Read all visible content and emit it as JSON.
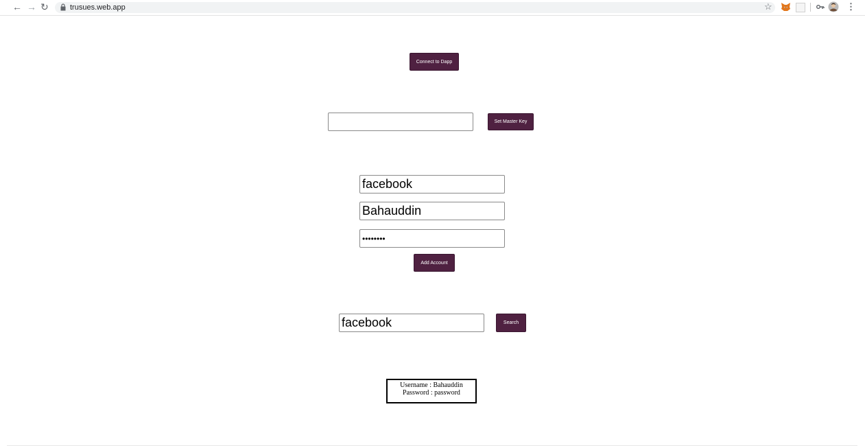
{
  "browser": {
    "url": "trusues.web.app",
    "icons": [
      "back-icon",
      "forward-icon",
      "reload-icon",
      "lock-icon",
      "star-icon",
      "metamask-icon",
      "extension-icon",
      "key-icon",
      "profile-avatar",
      "menu-icon"
    ]
  },
  "connect": {
    "label": "Connect to Dapp"
  },
  "master_key": {
    "value": "",
    "button_label": "Set Master Key"
  },
  "account": {
    "site_value": "facebook",
    "username_value": "Bahauddin",
    "password_value": "password",
    "button_label": "Add Account"
  },
  "search": {
    "value": "facebook",
    "button_label": "Search"
  },
  "result": {
    "username_line": "Username : Bahauddin",
    "password_line": "Password : password"
  },
  "colors": {
    "button": "#4f2141"
  }
}
